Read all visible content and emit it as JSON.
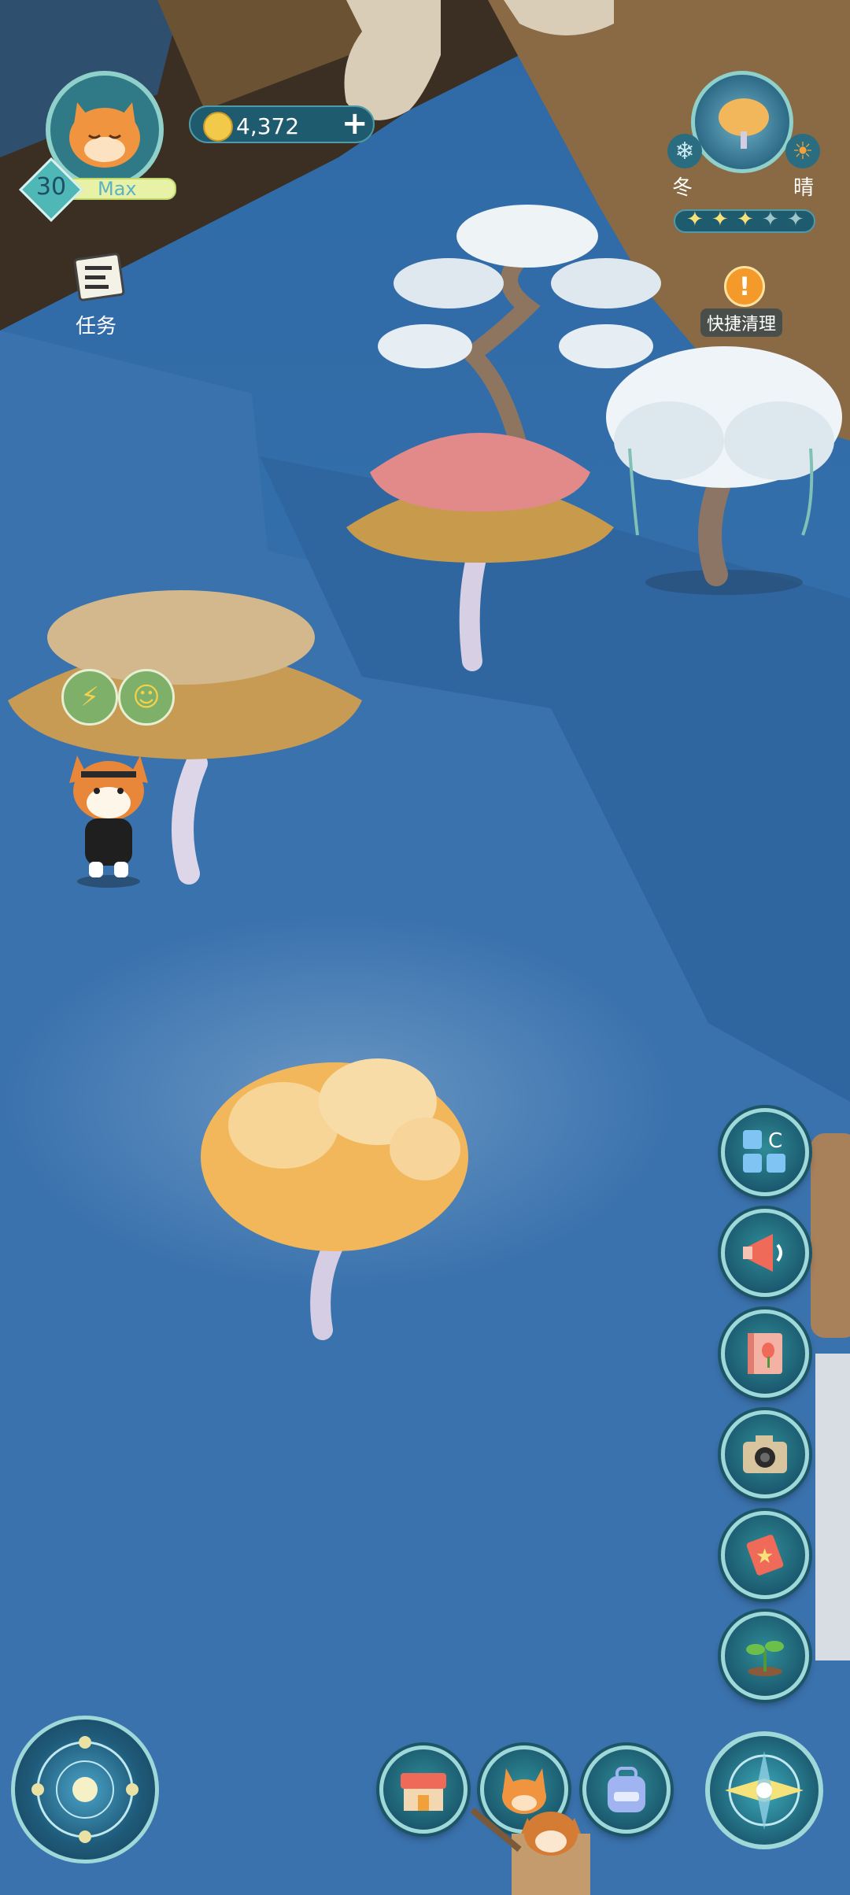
{
  "player": {
    "level": "30",
    "name": "Max",
    "avatar_icon": "fox-sleeping-icon"
  },
  "currency": {
    "coins": "4,372",
    "coin_icon": "coin-icon",
    "add_icon": "plus-icon"
  },
  "tasks": {
    "label": "任务",
    "icon": "task-list-icon"
  },
  "weather": {
    "season": "冬",
    "condition": "晴",
    "stars_filled": 3,
    "stars_total": 5
  },
  "quick_clean": {
    "label": "快捷清理",
    "icon": "alert-icon"
  },
  "character_status": {
    "energy_icon": "lightning-icon",
    "mood_icon": "smile-icon"
  },
  "side_menu": [
    {
      "name": "collection-button",
      "icon": "grid-c-icon"
    },
    {
      "name": "announcement-button",
      "icon": "megaphone-icon"
    },
    {
      "name": "guidebook-button",
      "icon": "book-tulip-icon"
    },
    {
      "name": "camera-button",
      "icon": "camera-icon"
    },
    {
      "name": "event-button",
      "icon": "scroll-star-icon"
    },
    {
      "name": "plant-button",
      "icon": "sprout-icon"
    }
  ],
  "bottom_bar": {
    "magic_circle_icon": "magic-circle-icon",
    "shop_icon": "shop-icon",
    "character_icon": "fox-face-icon",
    "backpack_icon": "backpack-icon",
    "compass_icon": "compass-icon"
  },
  "colors": {
    "water": "#3a6ea8",
    "hud_teal": "#1d5e73",
    "coin": "#f3c94a",
    "level_badge": "#4fb7b6"
  }
}
